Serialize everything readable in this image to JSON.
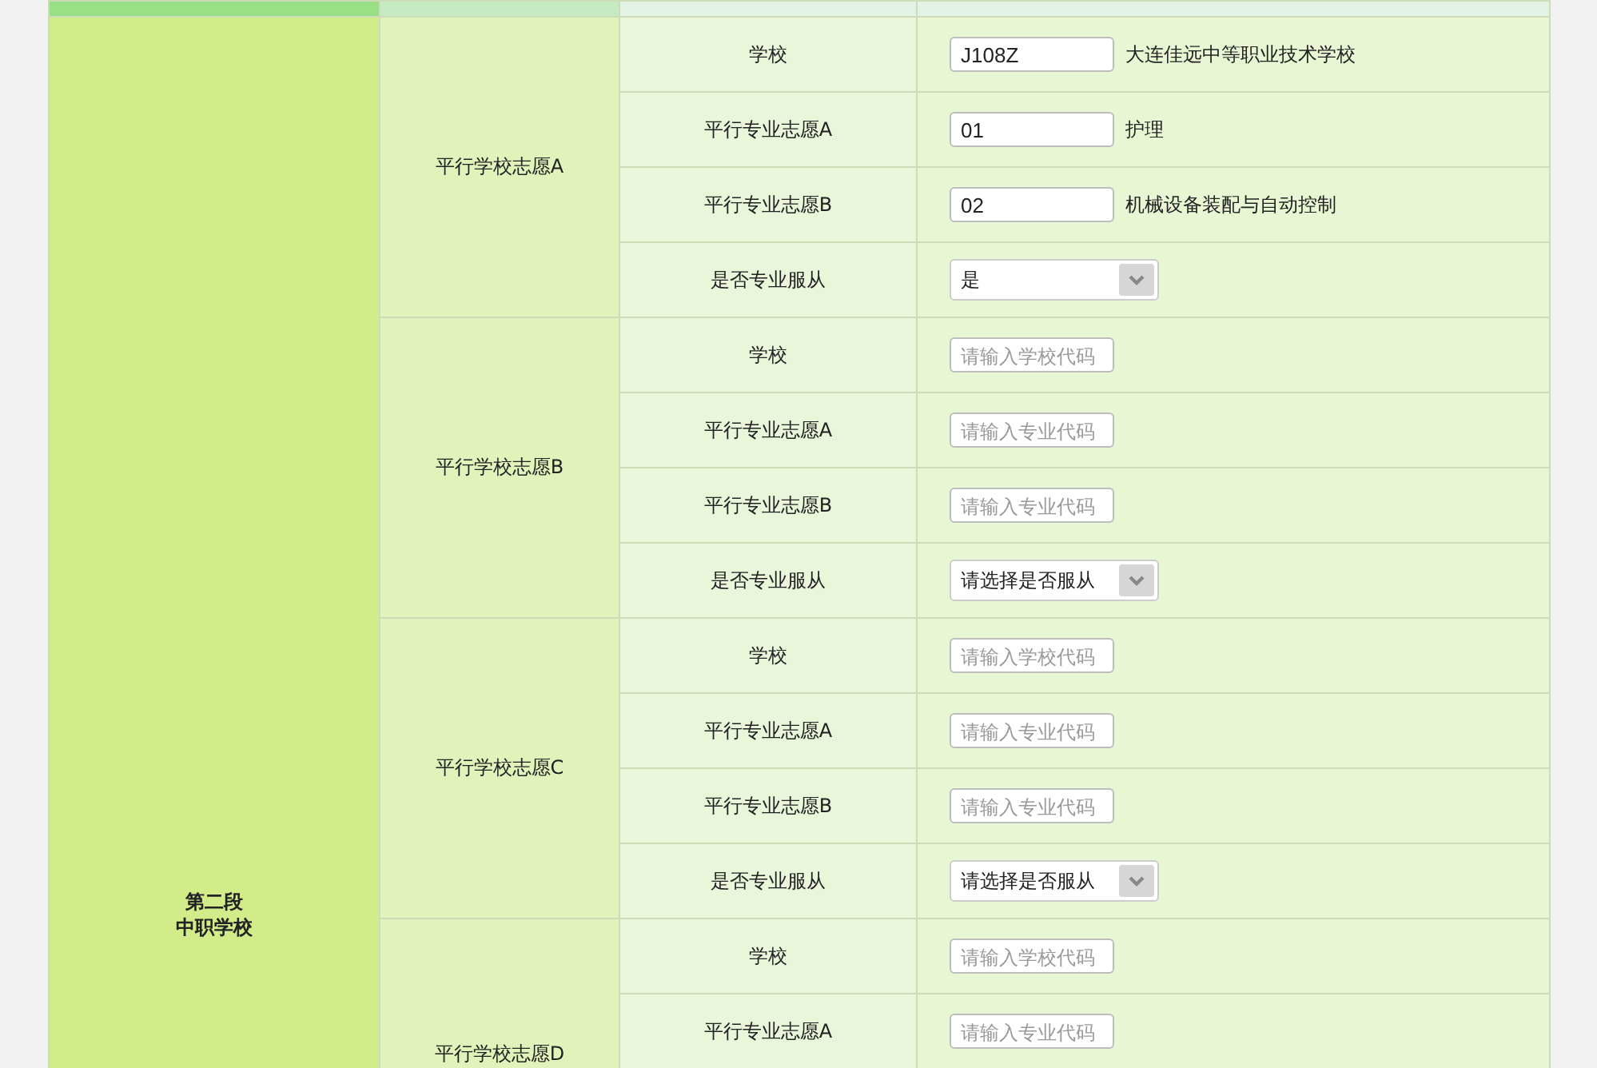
{
  "section": {
    "lines": [
      "第二段",
      "中职学校"
    ]
  },
  "groups": [
    {
      "label": "平行学校志愿A",
      "rows": [
        {
          "label": "学校",
          "kind": "input",
          "value": "J108Z",
          "note": "大连佳远中等职业技术学校"
        },
        {
          "label": "平行专业志愿A",
          "kind": "input",
          "value": "01",
          "note": "护理"
        },
        {
          "label": "平行专业志愿B",
          "kind": "input",
          "value": "02",
          "note": "机械设备装配与自动控制"
        },
        {
          "label": "是否专业服从",
          "kind": "select",
          "value": "是"
        }
      ]
    },
    {
      "label": "平行学校志愿B",
      "rows": [
        {
          "label": "学校",
          "kind": "input",
          "placeholder": "请输入学校代码"
        },
        {
          "label": "平行专业志愿A",
          "kind": "input",
          "placeholder": "请输入专业代码"
        },
        {
          "label": "平行专业志愿B",
          "kind": "input",
          "placeholder": "请输入专业代码"
        },
        {
          "label": "是否专业服从",
          "kind": "select",
          "value": "请选择是否服从"
        }
      ]
    },
    {
      "label": "平行学校志愿C",
      "rows": [
        {
          "label": "学校",
          "kind": "input",
          "placeholder": "请输入学校代码"
        },
        {
          "label": "平行专业志愿A",
          "kind": "input",
          "placeholder": "请输入专业代码"
        },
        {
          "label": "平行专业志愿B",
          "kind": "input",
          "placeholder": "请输入专业代码"
        },
        {
          "label": "是否专业服从",
          "kind": "select",
          "value": "请选择是否服从"
        }
      ]
    },
    {
      "label": "平行学校志愿D",
      "rows": [
        {
          "label": "学校",
          "kind": "input",
          "placeholder": "请输入学校代码"
        },
        {
          "label": "平行专业志愿A",
          "kind": "input",
          "placeholder": "请输入专业代码"
        }
      ]
    }
  ]
}
